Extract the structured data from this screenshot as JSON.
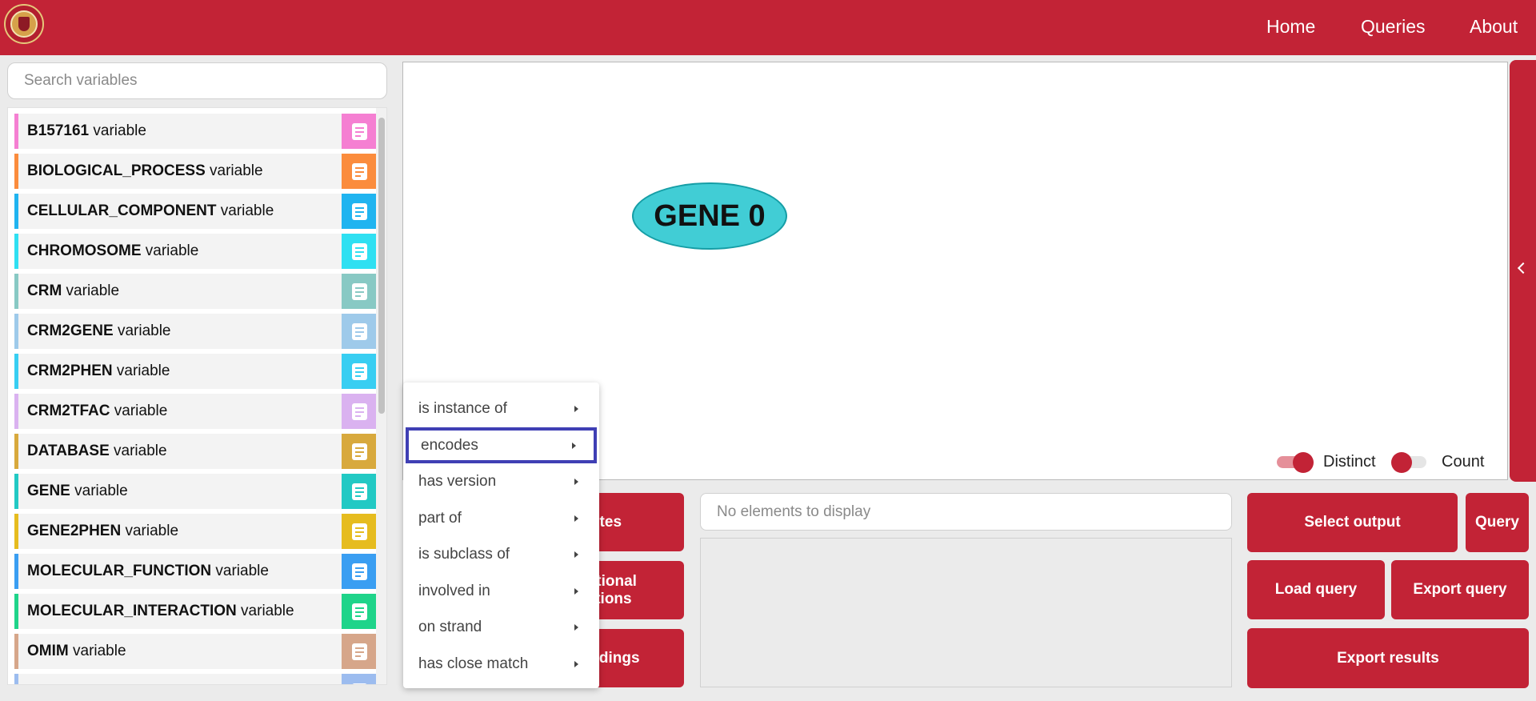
{
  "header": {
    "nav": [
      "Home",
      "Queries",
      "About"
    ]
  },
  "search": {
    "placeholder": "Search variables"
  },
  "variables": [
    {
      "name": "B157161",
      "suffix": " variable",
      "color": "#f57fd2"
    },
    {
      "name": "BIOLOGICAL_PROCESS",
      "suffix": " variable",
      "color": "#fb8c3d"
    },
    {
      "name": "CELLULAR_COMPONENT",
      "suffix": " variable",
      "color": "#20b4f0"
    },
    {
      "name": "CHROMOSOME",
      "suffix": " variable",
      "color": "#2fe0f2"
    },
    {
      "name": "CRM",
      "suffix": " variable",
      "color": "#88c9c4"
    },
    {
      "name": "CRM2GENE",
      "suffix": " variable",
      "color": "#9ecaea"
    },
    {
      "name": "CRM2PHEN",
      "suffix": " variable",
      "color": "#38cef2"
    },
    {
      "name": "CRM2TFAC",
      "suffix": " variable",
      "color": "#dab2f0"
    },
    {
      "name": "DATABASE",
      "suffix": " variable",
      "color": "#d8a93d"
    },
    {
      "name": "GENE",
      "suffix": " variable",
      "color": "#22c9c4"
    },
    {
      "name": "GENE2PHEN",
      "suffix": " variable",
      "color": "#e6bc1f"
    },
    {
      "name": "MOLECULAR_FUNCTION",
      "suffix": " variable",
      "color": "#3a9ef2"
    },
    {
      "name": "MOLECULAR_INTERACTION",
      "suffix": " variable",
      "color": "#1fd48a"
    },
    {
      "name": "OMIM",
      "suffix": " variable",
      "color": "#d6a68a"
    },
    {
      "name": "",
      "suffix": "",
      "color": "#9cbcef"
    }
  ],
  "canvas": {
    "node_label": "GENE 0",
    "toggles": [
      {
        "label": "Distinct",
        "on": true
      },
      {
        "label": "Count",
        "on": false
      }
    ]
  },
  "left_buttons": [
    {
      "label": "utes"
    },
    {
      "label": "optional\nlations"
    },
    {
      "label": "bindings"
    }
  ],
  "elements": {
    "empty_text": "No elements to display"
  },
  "action_buttons": {
    "select_output": "Select output",
    "query": "Query",
    "load_query": "Load query",
    "export_query": "Export query",
    "export_results": "Export results"
  },
  "context_menu": {
    "items": [
      "is instance of",
      "encodes",
      "has version",
      "part of",
      "is subclass of",
      "involved in",
      "on strand",
      "has close match"
    ],
    "active_index": 1
  },
  "theme": {
    "primary": "#c22336",
    "node": "#41cdd5",
    "highlight": "#3f3fb4"
  }
}
